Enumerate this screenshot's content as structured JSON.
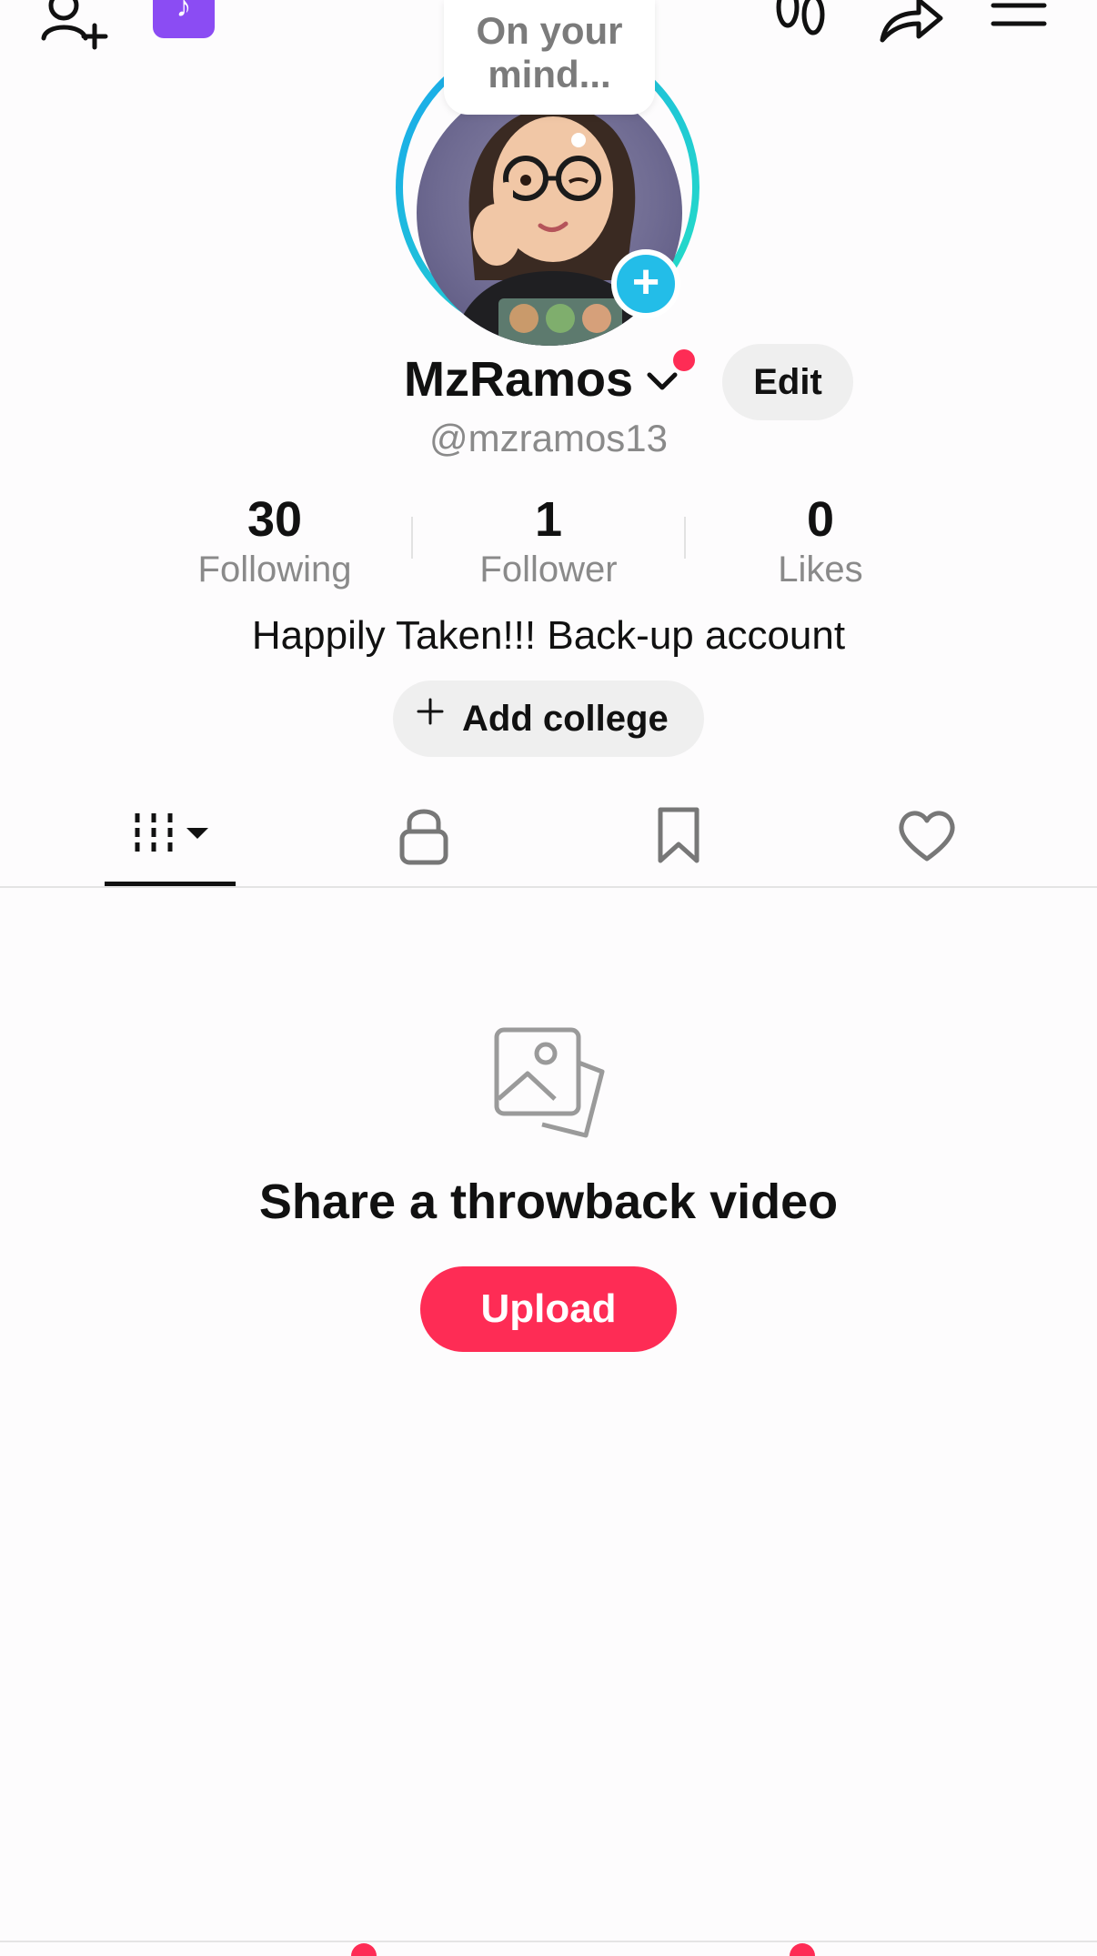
{
  "profile": {
    "display_name": "MzRamos",
    "handle": "@mzramos13",
    "bio": "Happily Taken!!! Back-up account",
    "thought_bubble": "On your mind...",
    "edit_label": "Edit",
    "add_college_label": "Add college"
  },
  "stats": [
    {
      "value": "30",
      "label": "Following"
    },
    {
      "value": "1",
      "label": "Follower"
    },
    {
      "value": "0",
      "label": "Likes"
    }
  ],
  "tabs": [
    {
      "icon": "grid-bars-icon"
    },
    {
      "icon": "lock-icon"
    },
    {
      "icon": "bookmark-icon"
    },
    {
      "icon": "heart-icon"
    }
  ],
  "empty_state": {
    "title": "Share a throwback video",
    "button_label": "Upload"
  },
  "colors": {
    "accent": "#fe2c55",
    "avatar_add": "#23bde8",
    "promo": "#8b4cf3"
  }
}
